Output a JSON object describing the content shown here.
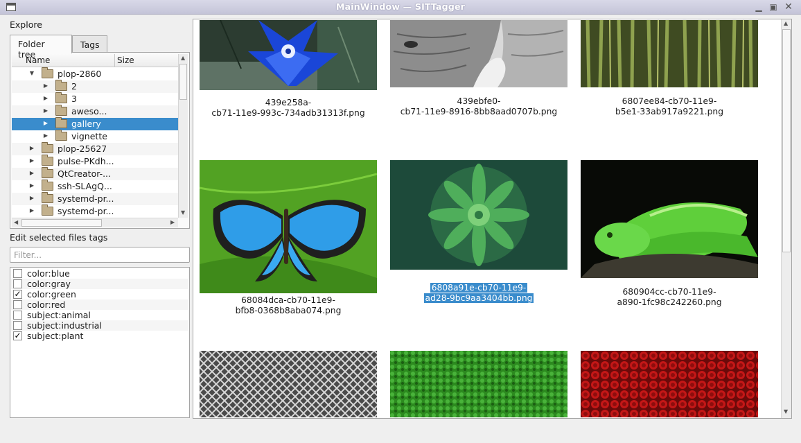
{
  "window": {
    "title": "MainWindow — SITTagger"
  },
  "left": {
    "explore_label": "Explore",
    "tabs": [
      {
        "label": "Folder tree"
      },
      {
        "label": "Tags"
      }
    ],
    "tree": {
      "columns": [
        "Name",
        "Size"
      ],
      "rows": [
        {
          "label": "plop-2860",
          "expanded": true
        },
        {
          "label": "2"
        },
        {
          "label": "3"
        },
        {
          "label": "aweso..."
        },
        {
          "label": "gallery",
          "selected": true
        },
        {
          "label": "vignette"
        },
        {
          "label": "plop-25627"
        },
        {
          "label": "pulse-PKdh..."
        },
        {
          "label": "QtCreator-..."
        },
        {
          "label": "ssh-SLAgQ..."
        },
        {
          "label": "systemd-pr..."
        },
        {
          "label": "systemd-pr..."
        }
      ]
    },
    "edit_label": "Edit selected files tags",
    "filter_placeholder": "Filter...",
    "tags": [
      {
        "label": "color:blue",
        "checked": false
      },
      {
        "label": "color:gray",
        "checked": false
      },
      {
        "label": "color:green",
        "checked": true
      },
      {
        "label": "color:red",
        "checked": false
      },
      {
        "label": "subject:animal",
        "checked": false
      },
      {
        "label": "subject:industrial",
        "checked": false
      },
      {
        "label": "subject:plant",
        "checked": true
      }
    ]
  },
  "gallery": {
    "items": [
      {
        "caption_line1": "439e258a-",
        "caption_line2": "cb71-11e9-993c-734adb31313f.png",
        "subject": "blue flower"
      },
      {
        "caption_line1": "439ebfe0-",
        "caption_line2": "cb71-11e9-8916-8bb8aad0707b.png",
        "subject": "elephant grayscale"
      },
      {
        "caption_line1": "6807ee84-cb70-11e9-",
        "caption_line2": "b5e1-33ab917a9221.png",
        "subject": "bamboo forest"
      },
      {
        "caption_line1": "68084dca-cb70-11e9-",
        "caption_line2": "bfb8-0368b8aba074.png",
        "subject": "blue butterfly"
      },
      {
        "caption_line1": "6808a91e-cb70-11e9-",
        "caption_line2": "ad28-9bc9aa3404bb.png",
        "subject": "green succulent",
        "selected": true
      },
      {
        "caption_line1": "680904cc-cb70-11e9-",
        "caption_line2": "a890-1fc98c242260.png",
        "subject": "green snake"
      },
      {
        "caption_line1": "",
        "caption_line2": "",
        "subject": "metal mesh"
      },
      {
        "caption_line1": "",
        "caption_line2": "",
        "subject": "green grass"
      },
      {
        "caption_line1": "",
        "caption_line2": "",
        "subject": "red roses"
      }
    ]
  },
  "colors": {
    "selection": "#3a8ccc",
    "titlebar": "#c8c8dc"
  }
}
